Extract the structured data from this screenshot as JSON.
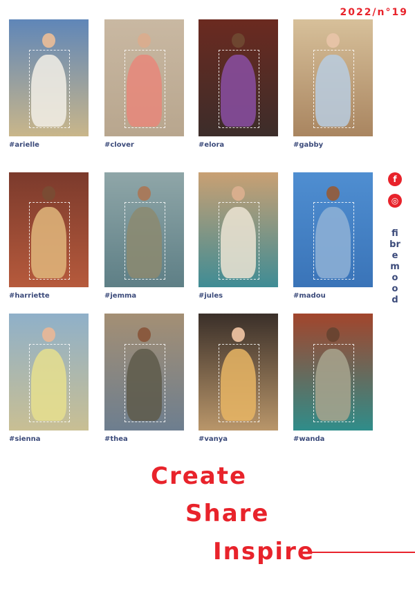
{
  "issue": "2022/n°19",
  "looks": [
    {
      "tag": "#arielle",
      "bg": [
        "#5f86b8",
        "#c9b68a"
      ],
      "outfit": "#f2efe6",
      "skin": "#e0b99a"
    },
    {
      "tag": "#clover",
      "bg": [
        "#c9b8a2",
        "#b8a68e"
      ],
      "outfit": "#e8877a",
      "skin": "#d9ad8f"
    },
    {
      "tag": "#elora",
      "bg": [
        "#6b2a20",
        "#3c2d2a"
      ],
      "outfit": "#8a4fa3",
      "skin": "#6e4630"
    },
    {
      "tag": "#gabby",
      "bg": [
        "#d7c09a",
        "#a98560"
      ],
      "outfit": "#b9cde0",
      "skin": "#e6c3a6"
    },
    {
      "tag": "#harriette",
      "bg": [
        "#7b3a2c",
        "#b65a3c"
      ],
      "outfit": "#e0b77c",
      "skin": "#7a4b33"
    },
    {
      "tag": "#jemma",
      "bg": [
        "#8fa6a8",
        "#5e7f86"
      ],
      "outfit": "#8c8a70",
      "skin": "#a77a5c"
    },
    {
      "tag": "#jules",
      "bg": [
        "#c9a073",
        "#3f8c95"
      ],
      "outfit": "#ece4d4",
      "skin": "#d8ae8d"
    },
    {
      "tag": "#madou",
      "bg": [
        "#4f8ed1",
        "#3a74b8"
      ],
      "outfit": "#8fb2d6",
      "skin": "#8e5f45"
    },
    {
      "tag": "#sienna",
      "bg": [
        "#8fb0c9",
        "#c9bf93"
      ],
      "outfit": "#e6df8e",
      "skin": "#e2b79a"
    },
    {
      "tag": "#thea",
      "bg": [
        "#a48f74",
        "#6d7e8f"
      ],
      "outfit": "#5e5a4a",
      "skin": "#8a5a3f"
    },
    {
      "tag": "#vanya",
      "bg": [
        "#3a2f29",
        "#b9966a"
      ],
      "outfit": "#e7b564",
      "skin": "#e2b99a"
    },
    {
      "tag": "#wanda",
      "bg": [
        "#a2452c",
        "#2f8d8a"
      ],
      "outfit": "#a8a58e",
      "skin": "#6a4431"
    }
  ],
  "social": {
    "facebook": "f",
    "instagram": "◎"
  },
  "brand": "fibremood",
  "slogan": [
    "Create",
    "Share",
    "Inspire"
  ],
  "colors": {
    "accent": "#e8232b",
    "tag": "#3b4a7a"
  }
}
